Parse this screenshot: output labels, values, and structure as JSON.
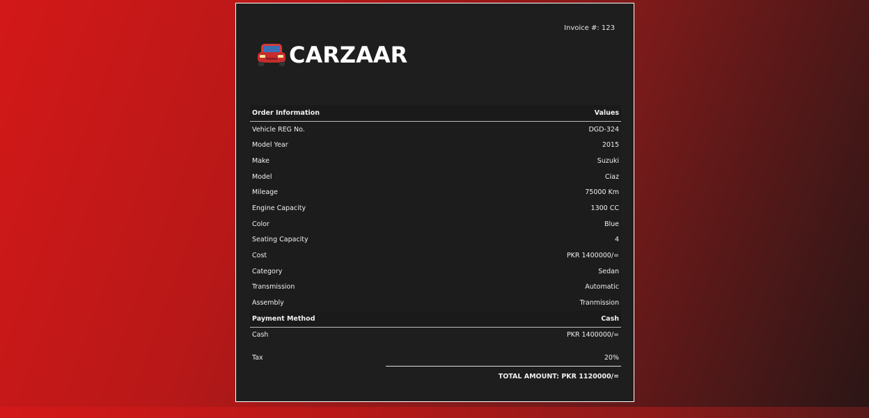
{
  "invoice": {
    "label": "Invoice #: 123"
  },
  "brand": {
    "name": "CARZAAR"
  },
  "order": {
    "header_left": "Order Information",
    "header_right": "Values",
    "rows": [
      {
        "label": "Vehicle REG No.",
        "value": "DGD-324"
      },
      {
        "label": "Model Year",
        "value": "2015"
      },
      {
        "label": "Make",
        "value": "Suzuki"
      },
      {
        "label": "Model",
        "value": "Ciaz"
      },
      {
        "label": "Mileage",
        "value": "75000 Km"
      },
      {
        "label": "Engine Capacity",
        "value": "1300 CC"
      },
      {
        "label": "Color",
        "value": "Blue"
      },
      {
        "label": "Seating Capacity",
        "value": "4"
      },
      {
        "label": "Cost",
        "value": "PKR 1400000/="
      },
      {
        "label": "Category",
        "value": "Sedan"
      },
      {
        "label": "Transmission",
        "value": "Automatic"
      },
      {
        "label": "Assembly",
        "value": "Tranmission"
      }
    ]
  },
  "payment": {
    "header_left": "Payment Method",
    "header_right": "Cash",
    "rows": [
      {
        "label": "Cash",
        "value": "PKR 1400000/="
      },
      {
        "label": "Tax",
        "value": "20%"
      }
    ],
    "total": "TOTAL AMOUNT: PKR 1120000/="
  }
}
